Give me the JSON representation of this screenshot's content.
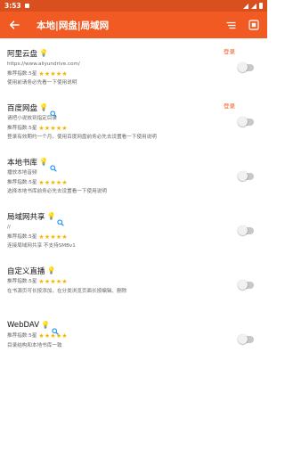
{
  "status_bar": {
    "time": "3:53"
  },
  "app_bar": {
    "title": "本地|网盘|局域网"
  },
  "items": [
    {
      "name": "阿里云盘",
      "line1": "https://www.aliyundrive.com/",
      "rating_label": "推荐指数:5星",
      "stars": "★★★★★",
      "line3": "使用前请务必先看一下使用说明",
      "login": "登录",
      "has_bulb": true,
      "has_search": false
    },
    {
      "name": "百度网盘",
      "line1": "请把小说放到指定目录",
      "rating_label": "推荐指数:5星",
      "stars": "★★★★★",
      "line3": "登录有效期约一个月。使用百度网盘前务必先去设置看一下使用说明",
      "login": "登录",
      "has_bulb": true,
      "has_search": true
    },
    {
      "name": "本地书库",
      "line1": "播放本地音频",
      "rating_label": "推荐指数:5星",
      "stars": "★★★★★",
      "line3": "选择本地书库前务必先去设置看一下使用说明",
      "login": "",
      "has_bulb": true,
      "has_search": true
    },
    {
      "name": "局域网共享",
      "line1": "//",
      "rating_label": "推荐指数:5星",
      "stars": "★★★★★",
      "line3": "连接局域网共享 不支持SMBv1",
      "login": "",
      "has_bulb": true,
      "has_search": true
    },
    {
      "name": "自定义直播",
      "line1": "",
      "rating_label": "推荐指数:5星",
      "stars": "★★★★★",
      "line3": "在书源页可长按添加，在分类浏览页面长按编辑、删除",
      "login": "",
      "has_bulb": true,
      "has_search": false
    },
    {
      "name": "WebDAV",
      "line1": "",
      "rating_label": "推荐指数:5星",
      "stars": "★★★★★",
      "line3": "目录结构和本地书库一致",
      "login": "",
      "has_bulb": true,
      "has_search": true
    }
  ],
  "colors": {
    "status_bar": "#d9501e",
    "app_bar": "#f15a22",
    "accent": "#f15a22",
    "stars": "#f7b500",
    "bulb": "#f2b705",
    "search": "#2196f3"
  },
  "icons": [
    "back-arrow-icon",
    "sort-icon",
    "qrcode-icon",
    "bulb-icon",
    "search-icon"
  ]
}
